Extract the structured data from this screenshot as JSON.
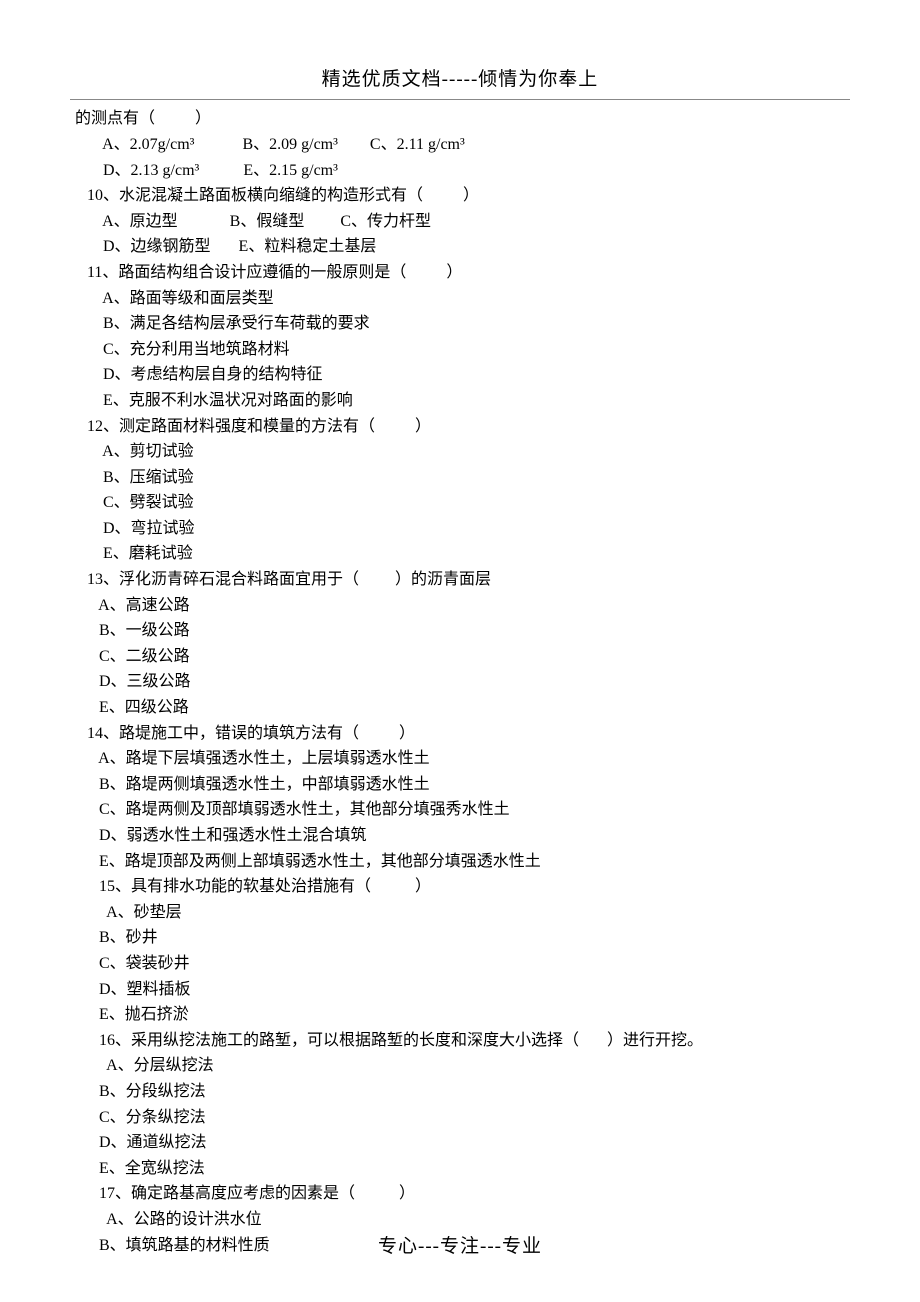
{
  "header": "精选优质文档-----倾情为你奉上",
  "footer": "专心---专注---专业",
  "lines": [
    "的测点有（          ）",
    "       A、2.07g/cm³            B、2.09 g/cm³        C、2.11 g/cm³",
    "       D、2.13 g/cm³           E、2.15 g/cm³",
    "   10、水泥混凝土路面板横向缩缝的构造形式有（          ）",
    "       A、原边型             B、假缝型         C、传力杆型",
    "       D、边缘钢筋型       E、粒料稳定土基层",
    "   11、路面结构组合设计应遵循的一般原则是（          ）",
    "       A、路面等级和面层类型",
    "       B、满足各结构层承受行车荷载的要求",
    "       C、充分利用当地筑路材料",
    "       D、考虑结构层自身的结构特征",
    "       E、克服不利水温状况对路面的影响",
    "   12、测定路面材料强度和模量的方法有（          ）",
    "       A、剪切试验",
    "       B、压缩试验",
    "       C、劈裂试验",
    "       D、弯拉试验",
    "       E、磨耗试验",
    "   13、浮化沥青碎石混合料路面宜用于（         ）的沥青面层",
    "      A、高速公路",
    "      B、一级公路",
    "      C、二级公路",
    "      D、三级公路",
    "      E、四级公路",
    "   14、路堤施工中，错误的填筑方法有（          ）",
    "      A、路堤下层填强透水性土，上层填弱透水性土",
    "      B、路堤两侧填强透水性土，中部填弱透水性土",
    "      C、路堤两侧及顶部填弱透水性土，其他部分填强秀水性土",
    "      D、弱透水性土和强透水性土混合填筑",
    "      E、路堤顶部及两侧上部填弱透水性土，其他部分填强透水性土",
    "      15、具有排水功能的软基处治措施有（           ）",
    "        A、砂垫层",
    "      B、砂井",
    "      C、袋装砂井",
    "      D、塑料插板",
    "      E、抛石挤淤",
    "      16、采用纵挖法施工的路堑，可以根据路堑的长度和深度大小选择（       ）进行开挖。",
    "        A、分层纵挖法",
    "      B、分段纵挖法",
    "      C、分条纵挖法",
    "      D、通道纵挖法",
    "      E、全宽纵挖法",
    "      17、确定路基高度应考虑的因素是（           ）",
    "        A、公路的设计洪水位",
    "      B、填筑路基的材料性质"
  ]
}
